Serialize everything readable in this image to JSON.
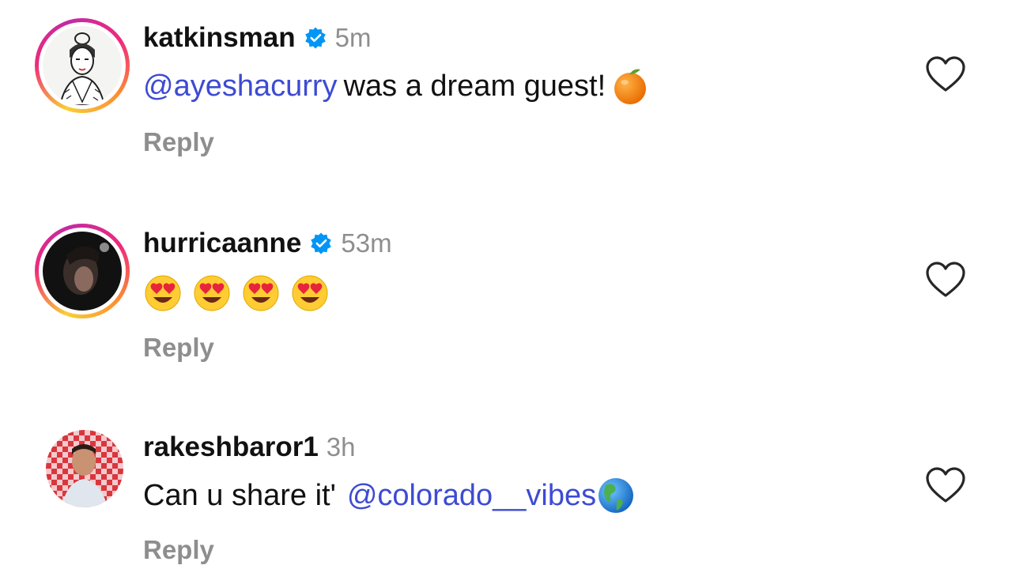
{
  "comments": [
    {
      "username": "katkinsman",
      "verified": true,
      "time": "5m",
      "mention": "@ayeshacurry",
      "text": "was a dream guest!",
      "emoji": "orange",
      "reply_label": "Reply"
    },
    {
      "username": "hurricaanne",
      "verified": true,
      "time": "53m",
      "emoji": "heart-eyes x4",
      "reply_label": "Reply"
    },
    {
      "username": "rakeshbaror1",
      "verified": false,
      "time": "3h",
      "text": "Can u share it'",
      "mention": "@colorado__vibes",
      "emoji": "globe-americas",
      "reply_label": "Reply"
    }
  ],
  "colors": {
    "mention": "#3e4bd2",
    "verified": "#0095f6",
    "muted": "#8e8e8e"
  }
}
